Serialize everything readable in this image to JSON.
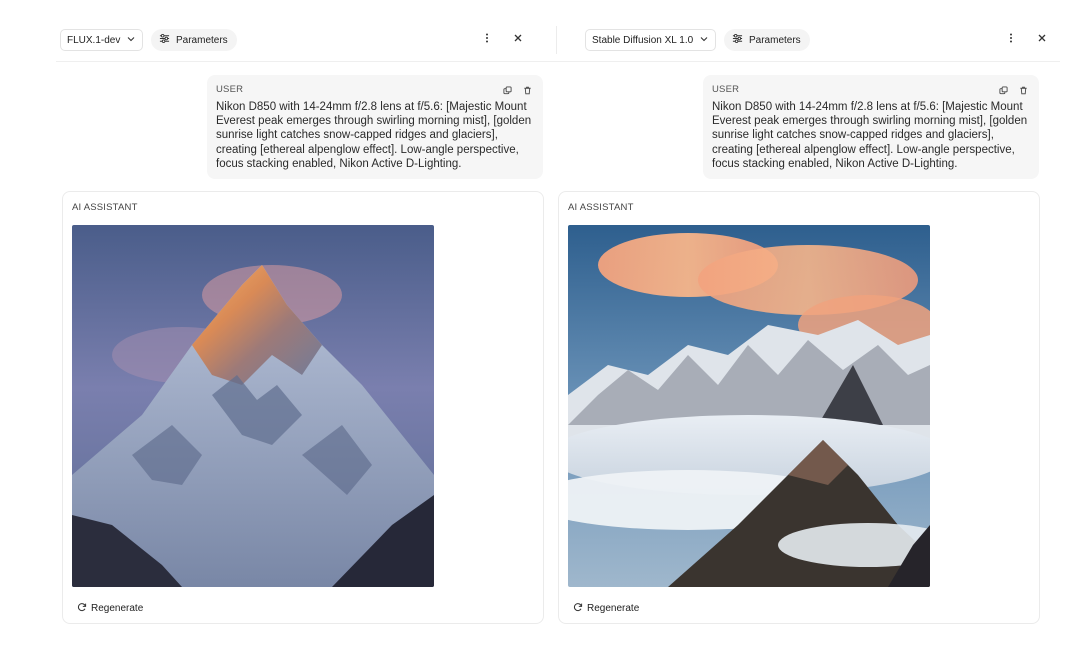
{
  "left": {
    "model": "FLUX.1-dev",
    "params_label": "Parameters",
    "user_role": "USER",
    "user_message": "Nikon D850 with 14-24mm f/2.8 lens at f/5.6: [Majestic Mount Everest peak emerges through swirling morning mist], [golden sunrise light catches snow-capped ridges and glaciers], creating [ethereal alpenglow effect]. Low-angle perspective, focus stacking enabled, Nikon Active D-Lighting.",
    "ai_role": "AI ASSISTANT",
    "regenerate_label": "Regenerate"
  },
  "right": {
    "model": "Stable Diffusion XL 1.0",
    "params_label": "Parameters",
    "user_role": "USER",
    "user_message": "Nikon D850 with 14-24mm f/2.8 lens at f/5.6: [Majestic Mount Everest peak emerges through swirling morning mist], [golden sunrise light catches snow-capped ridges and glaciers], creating [ethereal alpenglow effect]. Low-angle perspective, focus stacking enabled, Nikon Active D-Lighting.",
    "ai_role": "AI ASSISTANT",
    "regenerate_label": "Regenerate"
  },
  "icons": {
    "model_dropdown": "chevron-down-icon",
    "parameters": "sliders-icon",
    "more": "more-vertical-icon",
    "close": "close-icon",
    "copy": "copy-icon",
    "delete": "trash-icon",
    "regenerate": "refresh-icon"
  }
}
